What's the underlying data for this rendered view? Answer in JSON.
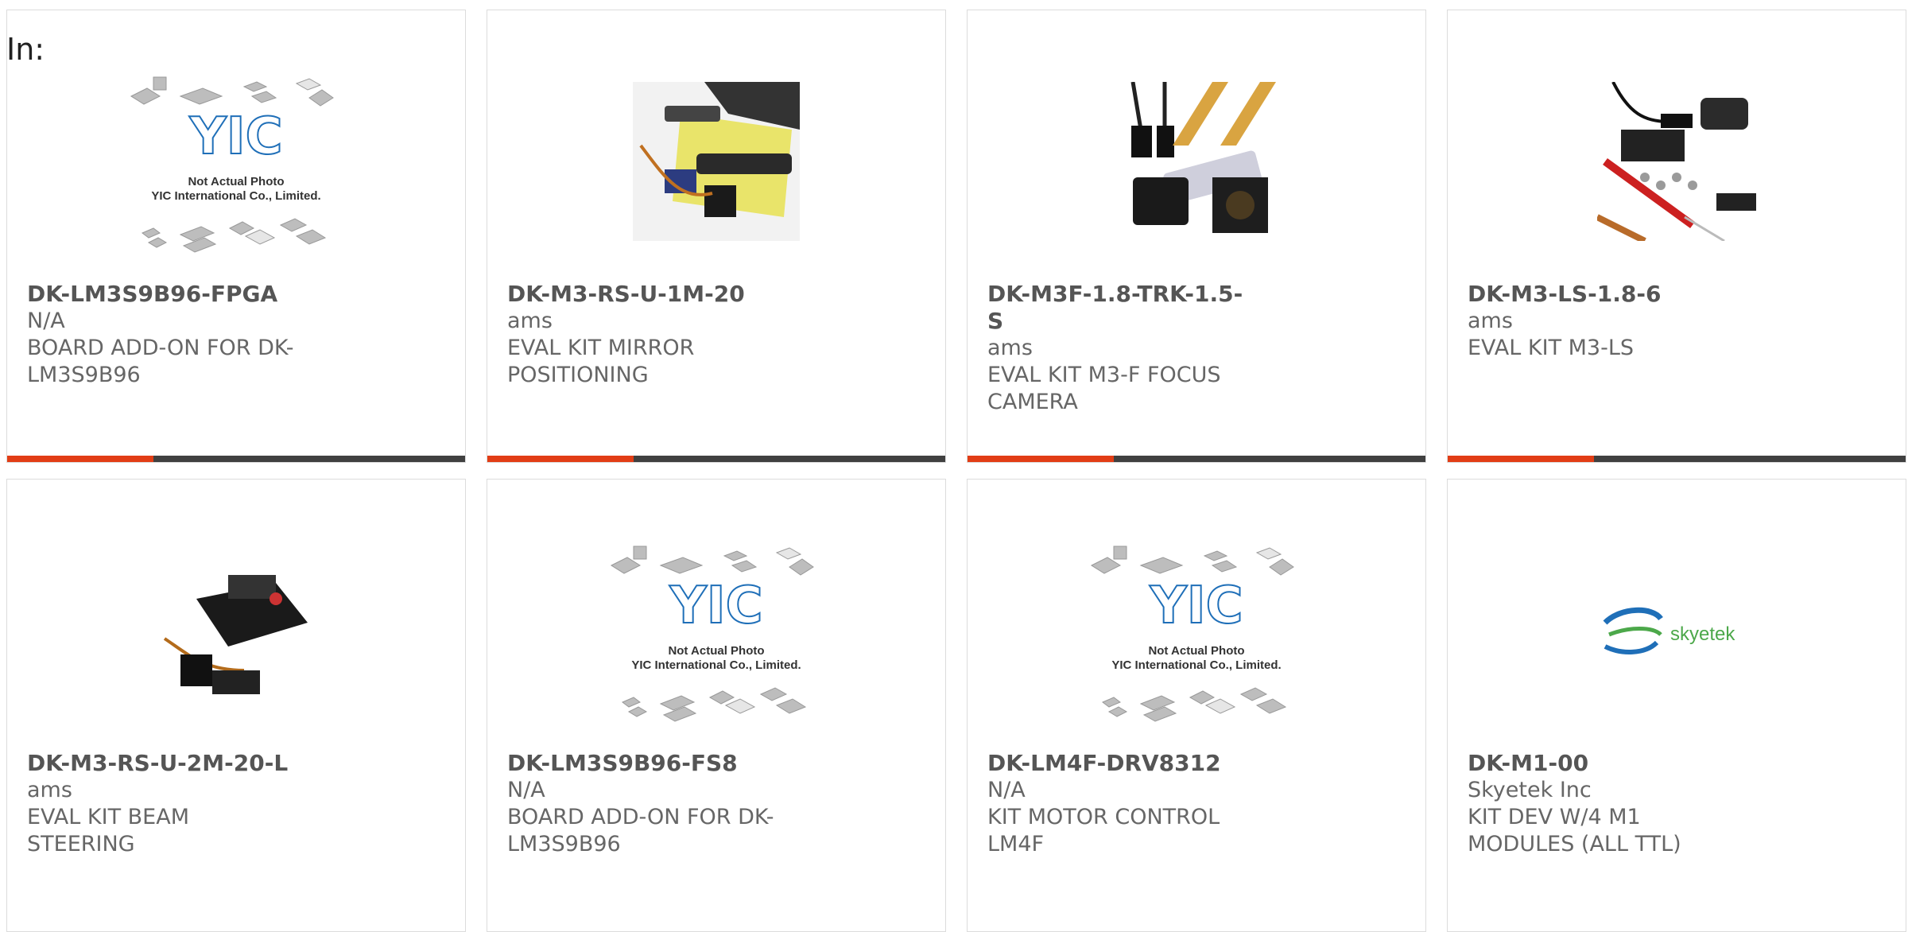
{
  "filter": {
    "in_label": "In:"
  },
  "placeholder_photo": {
    "line1": "Not Actual Photo",
    "line2": "YIC International Co., Limited.",
    "logo_text": "YIC"
  },
  "brand_logo_skyetek": "skyetek",
  "colors": {
    "accent_bar": "#e23d15",
    "bar": "#404040",
    "text": "#666666",
    "logo_blue": "#1f6fb8",
    "skyetek_green": "#4ca84a"
  },
  "products": [
    {
      "part": "DK-LM3S9B96-FPGA",
      "mfr": "N/A",
      "desc": "BOARD ADD-ON FOR DK-LM3S9B96",
      "image": "placeholder"
    },
    {
      "part": "DK-M3-RS-U-1M-20",
      "mfr": "ams",
      "desc": "EVAL KIT MIRROR POSITIONING",
      "image": "mirror-kit-photo"
    },
    {
      "part": "DK-M3F-1.8-TRK-1.5-S",
      "mfr": "ams",
      "desc": "EVAL KIT M3-F FOCUS CAMERA",
      "image": "camera-kit-photo"
    },
    {
      "part": "DK-M3-LS-1.8-6",
      "mfr": "ams",
      "desc": "EVAL KIT M3-LS",
      "image": "ls-kit-photo"
    },
    {
      "part": "DK-M3-RS-U-2M-20-L",
      "mfr": "ams",
      "desc": "EVAL KIT BEAM STEERING",
      "image": "beam-kit-photo"
    },
    {
      "part": "DK-LM3S9B96-FS8",
      "mfr": "N/A",
      "desc": "BOARD ADD-ON FOR DK-LM3S9B96",
      "image": "placeholder"
    },
    {
      "part": "DK-LM4F-DRV8312",
      "mfr": "N/A",
      "desc": "KIT MOTOR CONTROL LM4F",
      "image": "placeholder"
    },
    {
      "part": "DK-M1-00",
      "mfr": "Skyetek Inc",
      "desc": "KIT DEV W/4 M1 MODULES (ALL TTL)",
      "image": "skyetek-logo"
    }
  ]
}
